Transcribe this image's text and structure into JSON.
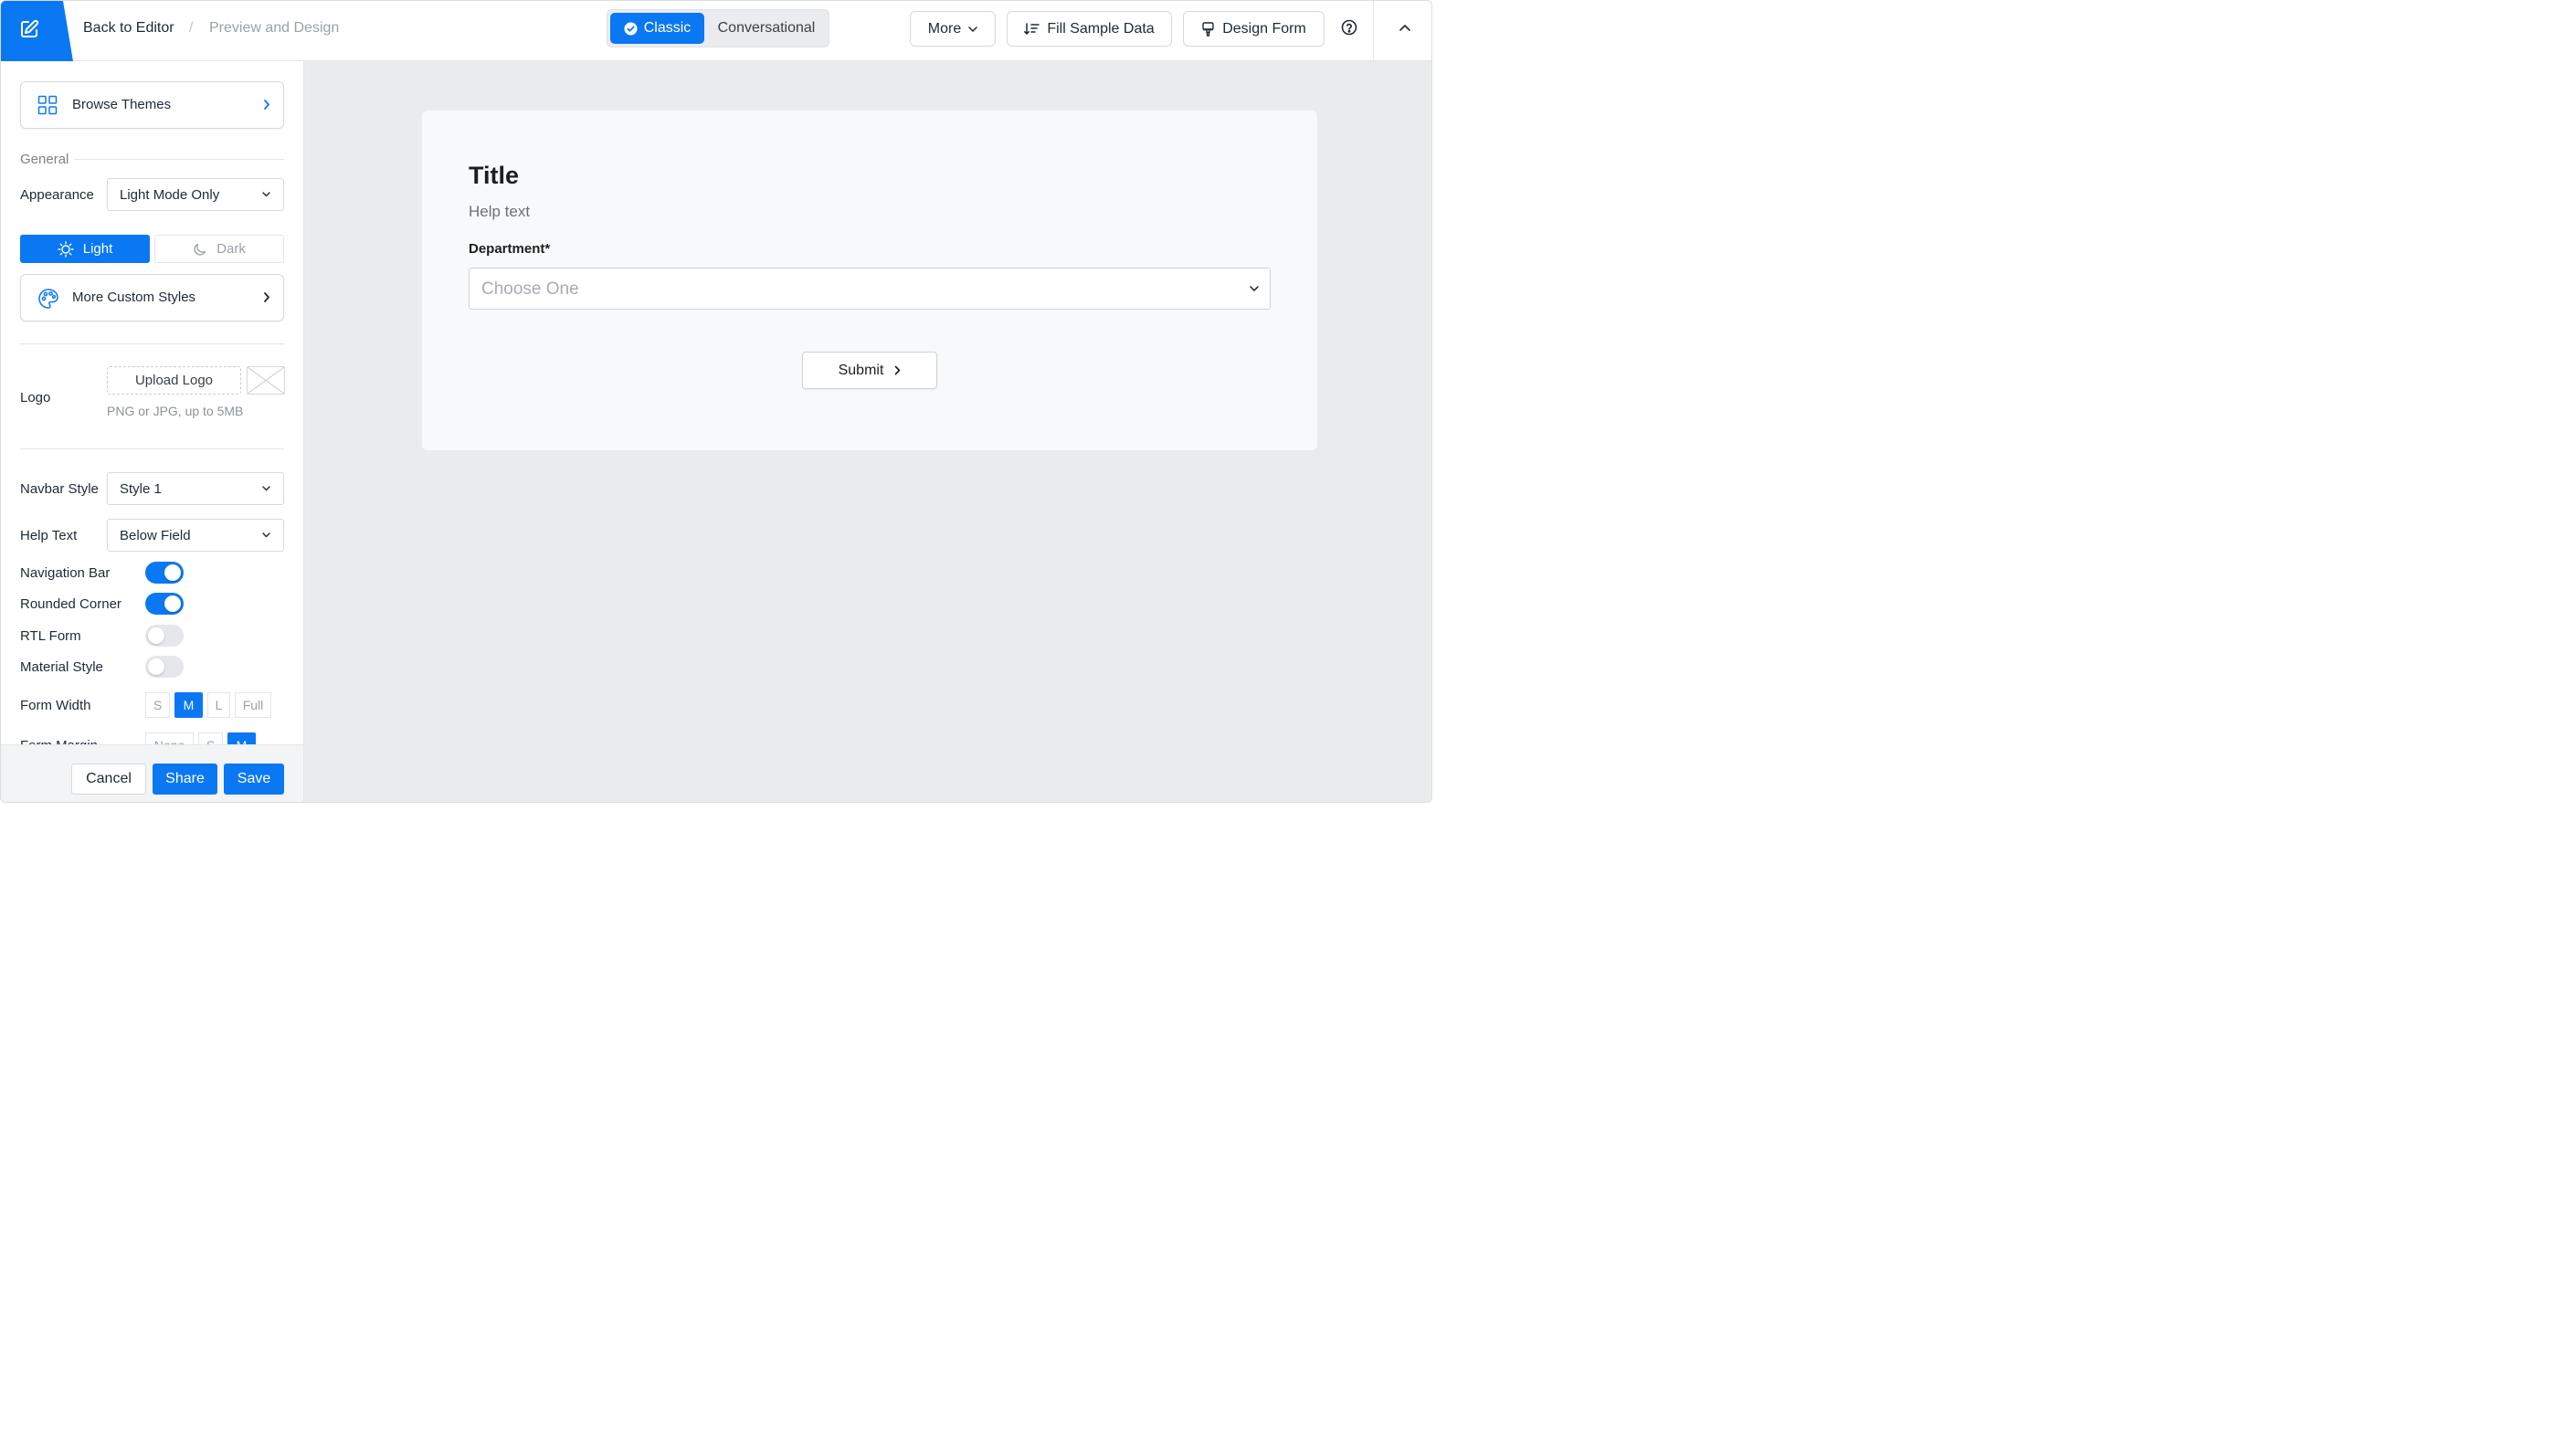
{
  "header": {
    "back_label": "Back to Editor",
    "separator": "/",
    "current_page": "Preview and Design",
    "mode_toggle": {
      "classic": "Classic",
      "conversational": "Conversational",
      "selected": "Classic"
    },
    "more_label": "More",
    "fill_sample_label": "Fill Sample Data",
    "design_form_label": "Design Form"
  },
  "sidebar": {
    "browse_themes": "Browse Themes",
    "general_label": "General",
    "appearance_label": "Appearance",
    "appearance_value": "Light Mode Only",
    "light_label": "Light",
    "dark_label": "Dark",
    "color_mode_selected": "Light",
    "more_custom_styles": "More Custom Styles",
    "logo_label": "Logo",
    "upload_logo": "Upload Logo",
    "upload_hint": "PNG or JPG, up to 5MB",
    "navbar_style_label": "Navbar Style",
    "navbar_style_value": "Style 1",
    "help_text_label": "Help Text",
    "help_text_value": "Below Field",
    "toggles": [
      {
        "label": "Navigation Bar",
        "on": true
      },
      {
        "label": "Rounded Corner",
        "on": true
      },
      {
        "label": "RTL Form",
        "on": false
      },
      {
        "label": "Material Style",
        "on": false
      }
    ],
    "form_width_label": "Form Width",
    "form_width_options": [
      "S",
      "M",
      "L",
      "Full"
    ],
    "form_width_selected": "M",
    "form_margin_label": "Form Margin",
    "form_margin_options": [
      "None",
      "S",
      "M"
    ],
    "form_margin_selected": "M"
  },
  "footer": {
    "cancel": "Cancel",
    "share": "Share",
    "save": "Save"
  },
  "form": {
    "title": "Title",
    "help_text": "Help text",
    "field_label": "Department*",
    "field_placeholder": "Choose One",
    "submit_label": "Submit"
  },
  "colors": {
    "accent": "#0a78f2",
    "preview_bg": "#eaebed",
    "card_bg": "#f8f9fa"
  }
}
